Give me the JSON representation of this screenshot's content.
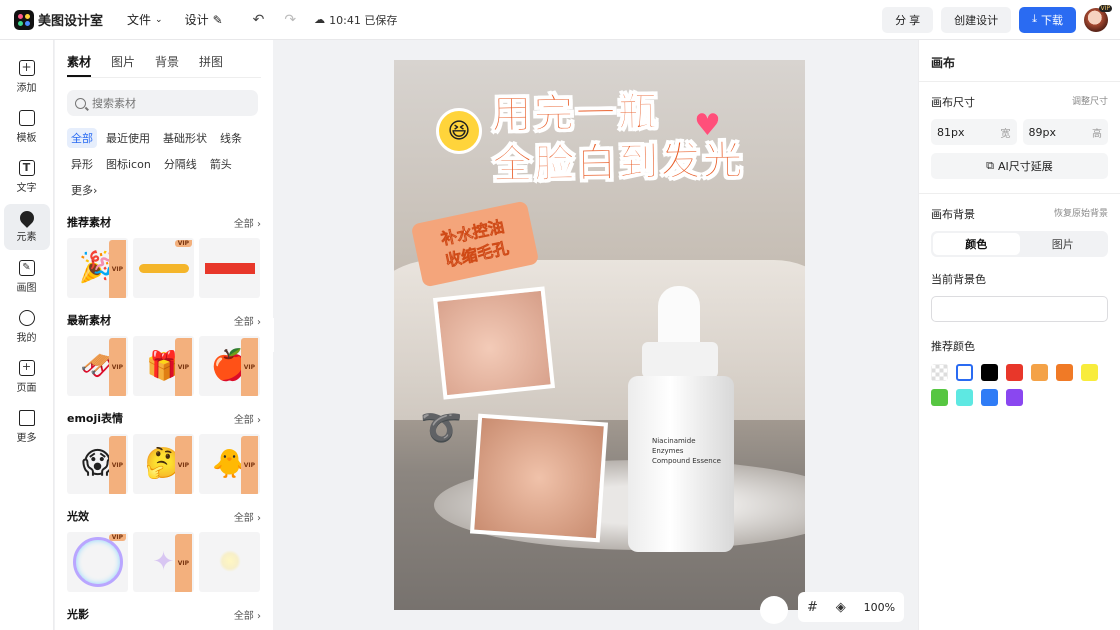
{
  "app": {
    "name": "美图设计室"
  },
  "topbar": {
    "menu": [
      {
        "label": "文件"
      },
      {
        "label": "设计"
      }
    ],
    "save_status": "10:41 已保存",
    "share_label": "分 享",
    "create_label": "创建设计",
    "download_label": "下载",
    "avatar_badge": "VIP"
  },
  "rail": {
    "items": [
      {
        "label": "添加",
        "icon": "plus-icon"
      },
      {
        "label": "模板",
        "icon": "template-icon"
      },
      {
        "label": "文字",
        "icon": "text-icon"
      },
      {
        "label": "元素",
        "icon": "element-icon",
        "active": true
      },
      {
        "label": "画图",
        "icon": "draw-icon"
      },
      {
        "label": "我的",
        "icon": "user-icon"
      },
      {
        "label": "页面",
        "icon": "page-icon"
      },
      {
        "label": "更多",
        "icon": "more-icon"
      }
    ]
  },
  "panel": {
    "tabs": [
      {
        "label": "素材",
        "active": true
      },
      {
        "label": "图片"
      },
      {
        "label": "背景"
      },
      {
        "label": "拼图"
      }
    ],
    "search_placeholder": "搜索素材",
    "chips": [
      "全部",
      "最近使用",
      "基础形状",
      "线条",
      "异形",
      "图标icon",
      "分隔线",
      "箭头",
      "更多"
    ],
    "all_label": "全部",
    "vip": "VIP",
    "sections": [
      {
        "title": "推荐素材"
      },
      {
        "title": "最新素材"
      },
      {
        "title": "emoji表情"
      },
      {
        "title": "光效"
      },
      {
        "title": "光影"
      }
    ]
  },
  "canvas": {
    "headline_1": "用完一瓶",
    "headline_2": "全脸白到发光",
    "ribbon_1": "补水控油",
    "ribbon_2": "收缩毛孔",
    "bottle_label": "Niacinamide\nEnzymes\nCompound Essence",
    "zoom": "100%"
  },
  "rpanel": {
    "title": "画布",
    "size_label": "画布尺寸",
    "size_adjust": "调整尺寸",
    "width_value": "81px",
    "width_unit": "宽",
    "height_value": "89px",
    "height_unit": "高",
    "ai_extend_label": "AI尺寸延展",
    "bg_label": "画布背景",
    "bg_restore": "恢复原始背景",
    "seg_color": "颜色",
    "seg_image": "图片",
    "current_bg_label": "当前背景色",
    "recommend_label": "推荐颜色",
    "swatches": [
      "transparent",
      "#ffffff",
      "#000000",
      "#e8372a",
      "#f4a247",
      "#f07a26",
      "#f8ec3c",
      "#56c641",
      "#5ee8e2",
      "#2f7cf6",
      "#8a47f0"
    ]
  }
}
